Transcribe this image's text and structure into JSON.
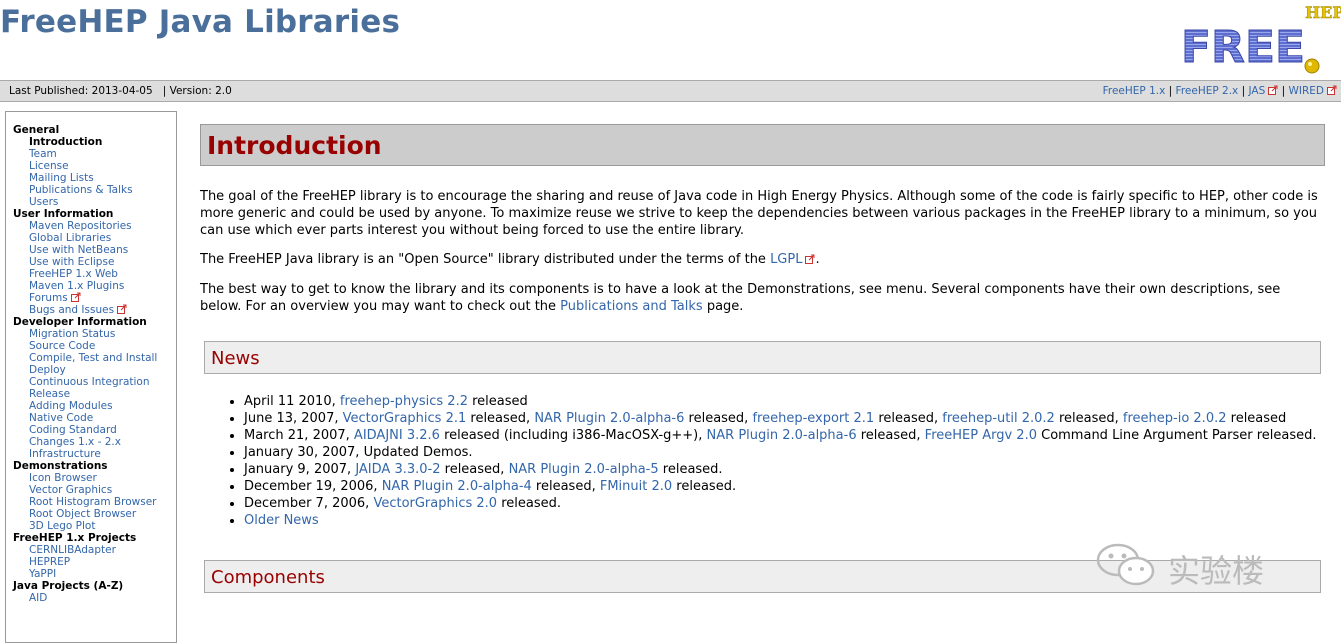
{
  "site": {
    "title": "FreeHEP Java Libraries",
    "logo_text": "FREE",
    "logo_side": "HEP",
    "last_published": "Last Published: 2013-04-05",
    "version": "Version: 2.0",
    "top_links": [
      "FreeHEP 1.x",
      "FreeHEP 2.x",
      "JAS",
      "WIRED"
    ]
  },
  "sidebar": {
    "sections": [
      {
        "title": "General",
        "items": [
          {
            "label": "Introduction",
            "active": true
          },
          {
            "label": "Team"
          },
          {
            "label": "License"
          },
          {
            "label": "Mailing Lists"
          },
          {
            "label": "Publications & Talks"
          },
          {
            "label": "Users"
          }
        ]
      },
      {
        "title": "User Information",
        "items": [
          {
            "label": "Maven Repositories"
          },
          {
            "label": "Global Libraries"
          },
          {
            "label": "Use with NetBeans"
          },
          {
            "label": "Use with Eclipse"
          },
          {
            "label": "FreeHEP 1.x Web"
          },
          {
            "label": "Maven 1.x Plugins"
          },
          {
            "label": "Forums",
            "ext": true
          },
          {
            "label": "Bugs and Issues",
            "ext": true
          }
        ]
      },
      {
        "title": "Developer Information",
        "items": [
          {
            "label": "Migration Status"
          },
          {
            "label": "Source Code"
          },
          {
            "label": "Compile, Test and Install"
          },
          {
            "label": "Deploy"
          },
          {
            "label": "Continuous Integration"
          },
          {
            "label": "Release"
          },
          {
            "label": "Adding Modules"
          },
          {
            "label": "Native Code"
          },
          {
            "label": "Coding Standard"
          },
          {
            "label": "Changes 1.x - 2.x"
          },
          {
            "label": "Infrastructure"
          }
        ]
      },
      {
        "title": "Demonstrations",
        "items": [
          {
            "label": "Icon Browser"
          },
          {
            "label": "Vector Graphics"
          },
          {
            "label": "Root Histogram Browser"
          },
          {
            "label": "Root Object Browser"
          },
          {
            "label": "3D Lego Plot"
          }
        ]
      },
      {
        "title": "FreeHEP 1.x Projects",
        "items": [
          {
            "label": "CERNLIBAdapter"
          },
          {
            "label": "HEPREP"
          },
          {
            "label": "YaPPI"
          }
        ]
      },
      {
        "title": "Java Projects (A-Z)",
        "items": [
          {
            "label": "AID"
          }
        ]
      }
    ]
  },
  "main": {
    "heading": "Introduction",
    "p1": "The goal of the FreeHEP library is to encourage the sharing and reuse of Java code in High Energy Physics. Although some of the code is fairly specific to HEP, other code is more generic and could be used by anyone. To maximize reuse we strive to keep the dependencies between various packages in the FreeHEP library to a minimum, so you can use which ever parts interest you without being forced to use the entire library.",
    "p2_pre": "The FreeHEP Java library is an \"Open Source\" library distributed under the terms of the ",
    "p2_link": "LGPL",
    "p2_post": ".",
    "p3_pre": "The best way to get to know the library and its components is to have a look at the Demonstrations, see menu. Several components have their own descriptions, see below. For an overview you may want to check out the ",
    "p3_link": "Publications and Talks",
    "p3_post": " page.",
    "news_heading": "News",
    "components_heading": "Components",
    "news": [
      [
        {
          "t": "April 11 2010, "
        },
        {
          "l": "freehep-physics 2.2"
        },
        {
          "t": " released"
        }
      ],
      [
        {
          "t": "June 13, 2007, "
        },
        {
          "l": "VectorGraphics 2.1"
        },
        {
          "t": " released, "
        },
        {
          "l": "NAR Plugin 2.0-alpha-6"
        },
        {
          "t": " released, "
        },
        {
          "l": "freehep-export 2.1"
        },
        {
          "t": " released, "
        },
        {
          "l": "freehep-util 2.0.2"
        },
        {
          "t": " released, "
        },
        {
          "l": "freehep-io 2.0.2"
        },
        {
          "t": " released"
        }
      ],
      [
        {
          "t": "March 21, 2007, "
        },
        {
          "l": "AIDAJNI 3.2.6"
        },
        {
          "t": " released (including i386-MacOSX-g++), "
        },
        {
          "l": "NAR Plugin 2.0-alpha-6"
        },
        {
          "t": " released, "
        },
        {
          "l": "FreeHEP Argv 2.0"
        },
        {
          "t": " Command Line Argument Parser released."
        }
      ],
      [
        {
          "t": "January 30, 2007, Updated Demos."
        }
      ],
      [
        {
          "t": "January 9, 2007, "
        },
        {
          "l": "JAIDA 3.3.0-2"
        },
        {
          "t": " released, "
        },
        {
          "l": "NAR Plugin 2.0-alpha-5"
        },
        {
          "t": " released."
        }
      ],
      [
        {
          "t": "December 19, 2006, "
        },
        {
          "l": "NAR Plugin 2.0-alpha-4"
        },
        {
          "t": " released, "
        },
        {
          "l": "FMinuit 2.0"
        },
        {
          "t": " released."
        }
      ],
      [
        {
          "t": "December 7, 2006, "
        },
        {
          "l": "VectorGraphics 2.0"
        },
        {
          "t": " released."
        }
      ],
      [
        {
          "l": "Older News"
        }
      ]
    ]
  },
  "watermark": {
    "text": "实验楼"
  }
}
